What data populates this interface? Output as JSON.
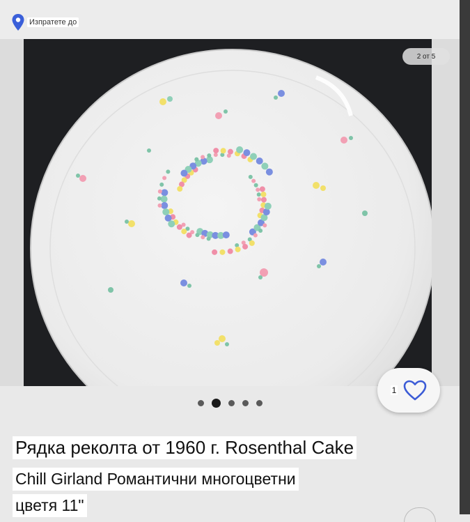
{
  "shipping": {
    "label": "Изпратете до",
    "icon": "location-pin-icon"
  },
  "gallery": {
    "counter": "2 от 5",
    "dots_total": 5,
    "dots_active": 2,
    "image": "Rosenthal cake plate with pastel floral wreath"
  },
  "favorite": {
    "count": "1",
    "icon": "heart-icon"
  },
  "listing": {
    "title_line1": "Рядка реколта от 1960 г. Rosenthal Cake",
    "title_line2": "Chill Girland Романтични многоцветни",
    "title_line3": "цветя 11\""
  },
  "colors": {
    "accent": "#3b5bd6",
    "pin": "#3a5fd9"
  }
}
